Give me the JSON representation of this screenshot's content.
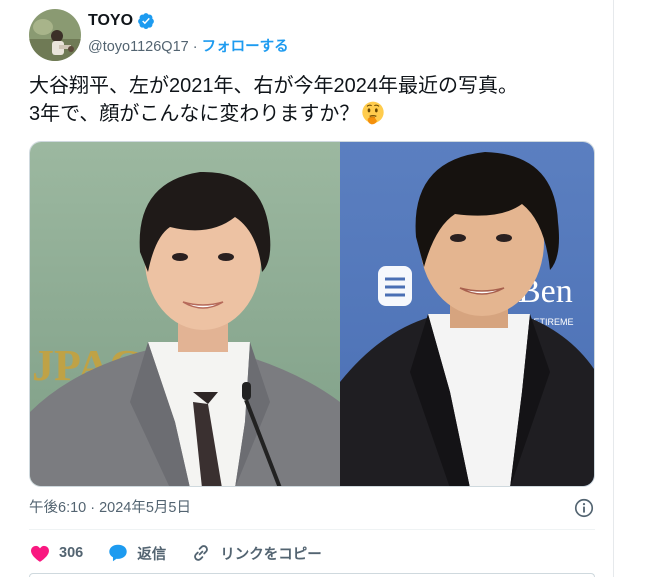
{
  "author": {
    "display_name": "TOYO",
    "handle": "@toyo1126Q17",
    "separator": " · ",
    "follow_label": "フォローする",
    "verified": true,
    "avatar_icon": "profile-photo"
  },
  "tweet": {
    "line1": "大谷翔平、左が2021年、右が今年2024年最近の写真。",
    "line2": "3年で、顔がこんなに変わりますか？",
    "emoji": "thinking-face-emoji",
    "timestamp": "午後6:10 · 2024年5月5日"
  },
  "media": {
    "left_banner_text": "JPAC",
    "right_banner_text": "Ben",
    "right_banner_subtext": "H RETIREME"
  },
  "actions": {
    "like_count": "306",
    "reply_label": "返信",
    "copy_link_label": "リンクをコピー"
  },
  "colors": {
    "accent": "#1d9bf0",
    "like": "#f91880",
    "text_secondary": "#536471"
  }
}
